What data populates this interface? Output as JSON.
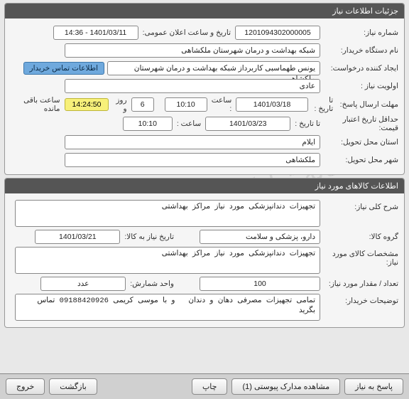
{
  "watermark": "سامانه تدارکات الکترونیکی دولت",
  "panel1": {
    "title": "جزئیات اطلاعات نیاز",
    "rows": {
      "need_no_label": "شماره نیاز:",
      "need_no": "1201094302000005",
      "announce_label": "تاریخ و ساعت اعلان عمومی:",
      "announce_value": "1401/03/11 - 14:36",
      "buyer_label": "نام دستگاه خریدار:",
      "buyer_value": "شبکه بهداشت و درمان شهرستان ملکشاهی",
      "creator_label": "ایجاد کننده درخواست:",
      "creator_value": "یونس طهماسبی کاربرداز شبکه بهداشت و درمان شهرستان ملکشاهی",
      "contact_chip": "اطلاعات تماس خریدار",
      "priority_label": "اولویت نیاز :",
      "priority_value": "عادی",
      "deadline_label": "مهلت ارسال پاسخ:",
      "to_date_label": "تا تاریخ :",
      "to_date1": "1401/03/18",
      "time_label": "ساعت :",
      "to_time1": "10:10",
      "days_value": "6",
      "days_text": "روز و",
      "remaining_time": "14:24:50",
      "remaining_text": "ساعت باقی مانده",
      "price_valid_label": "حداقل تاریخ اعتبار قیمت:",
      "to_date2": "1401/03/23",
      "to_time2": "10:10",
      "province_label": "استان محل تحویل:",
      "province_value": "ایلام",
      "city_label": "شهر محل تحویل:",
      "city_value": "ملکشاهی"
    }
  },
  "panel2": {
    "title": "اطلاعات کالاهای مورد نیاز",
    "rows": {
      "desc_label": "شرح کلی نیاز:",
      "desc_value": "تجهیزات دندانپزشکی مورد نیاز مراکز بهداشتی",
      "group_label": "گروه کالا:",
      "group_value": "دارو، پزشکی و سلامت",
      "need_date_label": "تاریخ نیاز به کالا:",
      "need_date_value": "1401/03/21",
      "spec_label": "مشخصات کالای مورد نیاز:",
      "spec_value": "تجهیزات دندانپزشکی مورد نیاز مراکز بهداشتی",
      "qty_label": "تعداد / مقدار مورد نیاز:",
      "qty_value": "100",
      "unit_label": "واحد شمارش:",
      "unit_value": "عدد",
      "buyer_notes_label": "توضیحات خریدار:",
      "buyer_notes_value": "تمامی تجهیزات مصرفی دهان و دندان   و با موسی کریمی 09188420926 تماس بگرید"
    }
  },
  "footer": {
    "reply": "پاسخ به نیاز",
    "attachments": "مشاهده مدارک پیوستی (1)",
    "print": "چاپ",
    "back": "بازگشت",
    "exit": "خروج"
  }
}
